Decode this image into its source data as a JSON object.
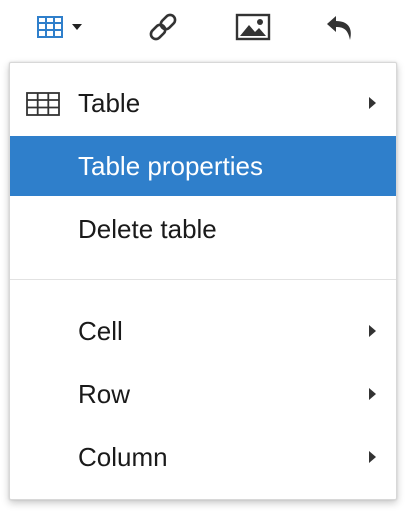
{
  "toolbar": {
    "buttons": [
      {
        "name": "table",
        "icon": "table-icon"
      },
      {
        "name": "link",
        "icon": "link-icon"
      },
      {
        "name": "image",
        "icon": "image-icon"
      },
      {
        "name": "undo",
        "icon": "undo-icon"
      }
    ],
    "accent_color": "#2f7fcb"
  },
  "menu": {
    "items": [
      {
        "label": "Table",
        "icon": "table-icon",
        "submenu": true
      },
      {
        "label": "Table properties",
        "active": true
      },
      {
        "label": "Delete table"
      },
      {
        "label": "Cell",
        "submenu": true
      },
      {
        "label": "Row",
        "submenu": true
      },
      {
        "label": "Column",
        "submenu": true
      }
    ],
    "highlight_color": "#2f7fcb"
  }
}
